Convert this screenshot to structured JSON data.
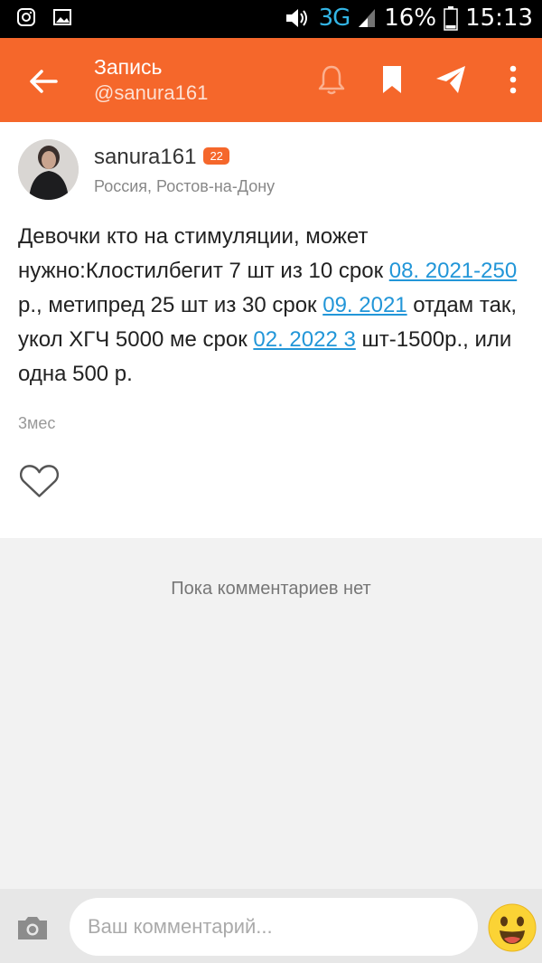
{
  "status_bar": {
    "network": "3G",
    "battery": "16%",
    "time": "15:13",
    "icons": [
      "instagram-icon",
      "image-icon",
      "volume-icon",
      "signal-icon",
      "battery-icon"
    ]
  },
  "appbar": {
    "title": "Запись",
    "subtitle": "@sanura161",
    "icons": [
      "back-arrow-icon",
      "bell-icon",
      "bookmark-icon",
      "share-icon",
      "more-icon"
    ]
  },
  "post": {
    "author": "sanura161",
    "level": "22",
    "location": "Россия, Ростов-на-Дону",
    "text_parts": [
      "Девочки кто на стимуляции, может нужно:Клостилбегит 7 шт из 10 срок ",
      "08. 2021-250",
      " р., метипред 25 шт из 30 срок ",
      "09. 2021",
      " отдам так, укол ХГЧ 5000 ме срок ",
      "02. 2022 3",
      " шт-1500р., или одна 500 р."
    ],
    "time": "3мес"
  },
  "comments": {
    "empty_text": "Пока комментариев нет"
  },
  "composer": {
    "placeholder": "Ваш комментарий..."
  },
  "colors": {
    "accent": "#f5672b",
    "link": "#2296d8",
    "comments_bg": "#f2f2f2"
  }
}
